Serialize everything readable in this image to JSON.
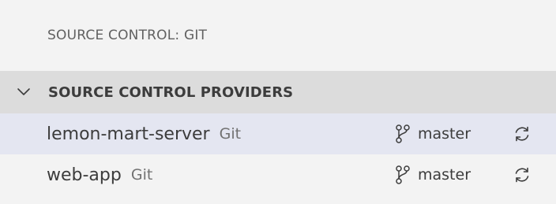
{
  "panel": {
    "title": "SOURCE CONTROL: GIT"
  },
  "section": {
    "title": "SOURCE CONTROL PROVIDERS",
    "expanded": true
  },
  "providers": [
    {
      "name": "lemon-mart-server",
      "provider": "Git",
      "branch": "master",
      "selected": true
    },
    {
      "name": "web-app",
      "provider": "Git",
      "branch": "master",
      "selected": false
    }
  ],
  "colors": {
    "background": "#f3f3f3",
    "section_header_bg": "#dcdcdc",
    "selected_row_bg": "#e4e6f1",
    "text": "#3c3c3c",
    "muted_text": "#717171"
  },
  "icons": {
    "section_toggle": "chevron-down-icon",
    "branch": "git-branch-icon",
    "sync": "sync-icon"
  }
}
